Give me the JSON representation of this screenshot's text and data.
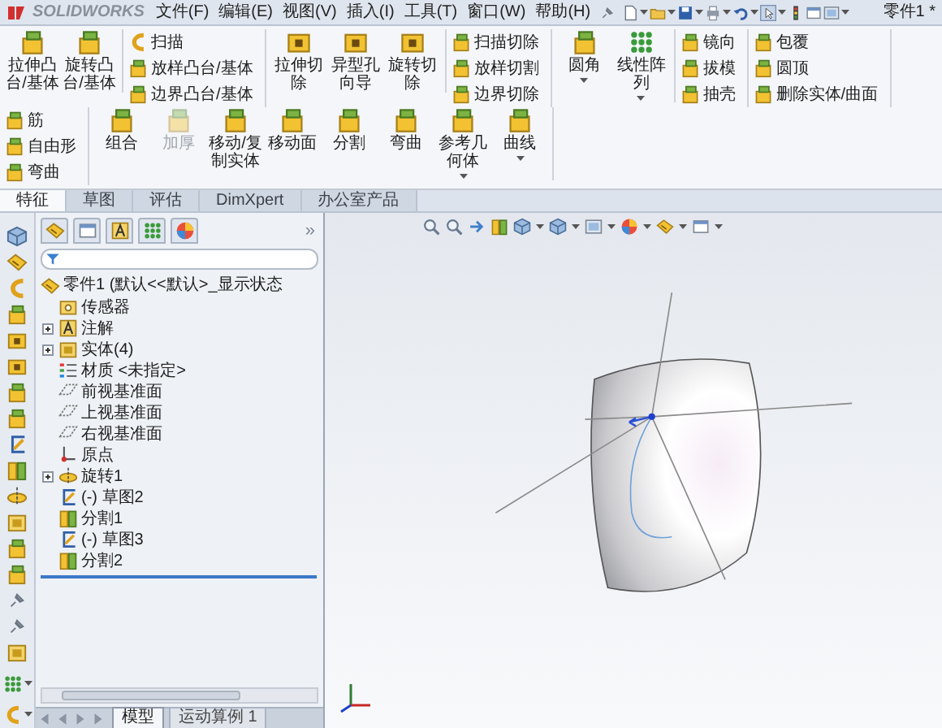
{
  "window": {
    "logo": "SOLIDWORKS",
    "title": "零件1 *"
  },
  "menu": [
    "文件(F)",
    "编辑(E)",
    "视图(V)",
    "插入(I)",
    "工具(T)",
    "窗口(W)",
    "帮助(H)"
  ],
  "ribbon": {
    "groups": [
      {
        "kind": "large",
        "buttons": [
          {
            "label": "拉伸凸台/基体",
            "disabled": false,
            "dropdown": false
          },
          {
            "label": "旋转凸台/基体",
            "disabled": false,
            "dropdown": false
          }
        ]
      },
      {
        "kind": "stack",
        "buttons": [
          "扫描",
          "放样凸台/基体",
          "边界凸台/基体"
        ]
      },
      {
        "kind": "large",
        "buttons": [
          {
            "label": "拉伸切除",
            "disabled": false,
            "dropdown": false
          },
          {
            "label": "异型孔向导",
            "disabled": false,
            "dropdown": false
          },
          {
            "label": "旋转切除",
            "disabled": false,
            "dropdown": false
          }
        ]
      },
      {
        "kind": "stack",
        "buttons": [
          "扫描切除",
          "放样切割",
          "边界切除"
        ]
      },
      {
        "kind": "large",
        "buttons": [
          {
            "label": "圆角",
            "disabled": false,
            "dropdown": true
          },
          {
            "label": "线性阵列",
            "disabled": false,
            "dropdown": true
          }
        ]
      },
      {
        "kind": "stack",
        "buttons": [
          "镜向",
          "拔模",
          "抽壳"
        ]
      },
      {
        "kind": "stack",
        "buttons": [
          "包覆",
          "圆顶",
          "删除实体/曲面"
        ]
      },
      {
        "kind": "stack",
        "buttons": [
          "筋",
          "自由形",
          "弯曲"
        ]
      },
      {
        "kind": "large",
        "buttons": [
          {
            "label": "组合",
            "disabled": false,
            "dropdown": false
          },
          {
            "label": "加厚",
            "disabled": true,
            "dropdown": false
          },
          {
            "label": "移动/复制实体",
            "disabled": false,
            "dropdown": false
          },
          {
            "label": "移动面",
            "disabled": false,
            "dropdown": false
          },
          {
            "label": "分割",
            "disabled": false,
            "dropdown": false
          },
          {
            "label": "弯曲",
            "disabled": false,
            "dropdown": false
          },
          {
            "label": "参考几何体",
            "disabled": false,
            "dropdown": true
          },
          {
            "label": "曲线",
            "disabled": false,
            "dropdown": true
          }
        ]
      }
    ]
  },
  "tabs": [
    {
      "label": "特征",
      "selected": true
    },
    {
      "label": "草图",
      "selected": false
    },
    {
      "label": "评估",
      "selected": false
    },
    {
      "label": "DimXpert",
      "selected": false
    },
    {
      "label": "办公室产品",
      "selected": false
    }
  ],
  "feature_manager": {
    "more": "»",
    "tree": {
      "label": "零件1 (默认<<默认>_显示状态",
      "children": [
        {
          "kind": "sensors",
          "label": "传感器"
        },
        {
          "kind": "annotations",
          "label": "注解",
          "expanded": false
        },
        {
          "kind": "bodies",
          "label": "实体(4)",
          "expanded": false
        },
        {
          "kind": "material",
          "label": "材质 <未指定>"
        },
        {
          "kind": "plane",
          "label": "前视基准面"
        },
        {
          "kind": "plane",
          "label": "上视基准面"
        },
        {
          "kind": "plane",
          "label": "右视基准面"
        },
        {
          "kind": "origin",
          "label": "原点"
        },
        {
          "kind": "revolve",
          "label": "旋转1",
          "expanded": false
        },
        {
          "kind": "sketch",
          "label": "(-) 草图2"
        },
        {
          "kind": "split",
          "label": "分割1"
        },
        {
          "kind": "sketch",
          "label": "(-) 草图3"
        },
        {
          "kind": "split",
          "label": "分割2"
        }
      ]
    }
  },
  "bottom_tabs": [
    {
      "label": "模型",
      "selected": true
    },
    {
      "label": "运动算例 1",
      "selected": false
    }
  ]
}
